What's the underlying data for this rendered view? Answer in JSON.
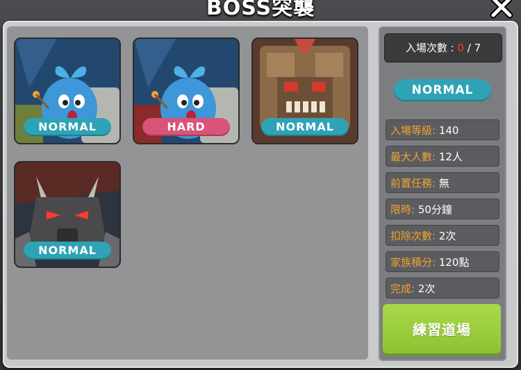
{
  "header": {
    "title": "BOSS突襲"
  },
  "cards": [
    {
      "difficulty": "NORMAL",
      "boss_art": "blue-sprout-creature"
    },
    {
      "difficulty": "HARD",
      "boss_art": "blue-sprout-creature"
    },
    {
      "difficulty": "NORMAL",
      "boss_art": "stone-golem"
    },
    {
      "difficulty": "NORMAL",
      "boss_art": "dark-armored-beast"
    }
  ],
  "side": {
    "entry_label": "入場次數 : ",
    "entry_current": "0",
    "entry_sep": " / ",
    "entry_max": "7",
    "difficulty": "NORMAL",
    "rows": [
      {
        "key": "入場等級:",
        "value": " 140"
      },
      {
        "key": "最大人數:",
        "value": " 12人"
      },
      {
        "key": "前置任務:",
        "value": " 無"
      },
      {
        "key": "限時:",
        "value": " 50分鐘"
      },
      {
        "key": "扣除次數:",
        "value": " 2次"
      },
      {
        "key": "家族積分:",
        "value": " 120點"
      },
      {
        "key": "完成:",
        "value": " 2次"
      }
    ],
    "practice_button": "練習道場"
  },
  "colors": {
    "normal": "#2fa3b6",
    "hard": "#d8547a",
    "key_text": "#f0a430",
    "practice": "#9acd3c",
    "entry_current": "#ff3b30"
  }
}
